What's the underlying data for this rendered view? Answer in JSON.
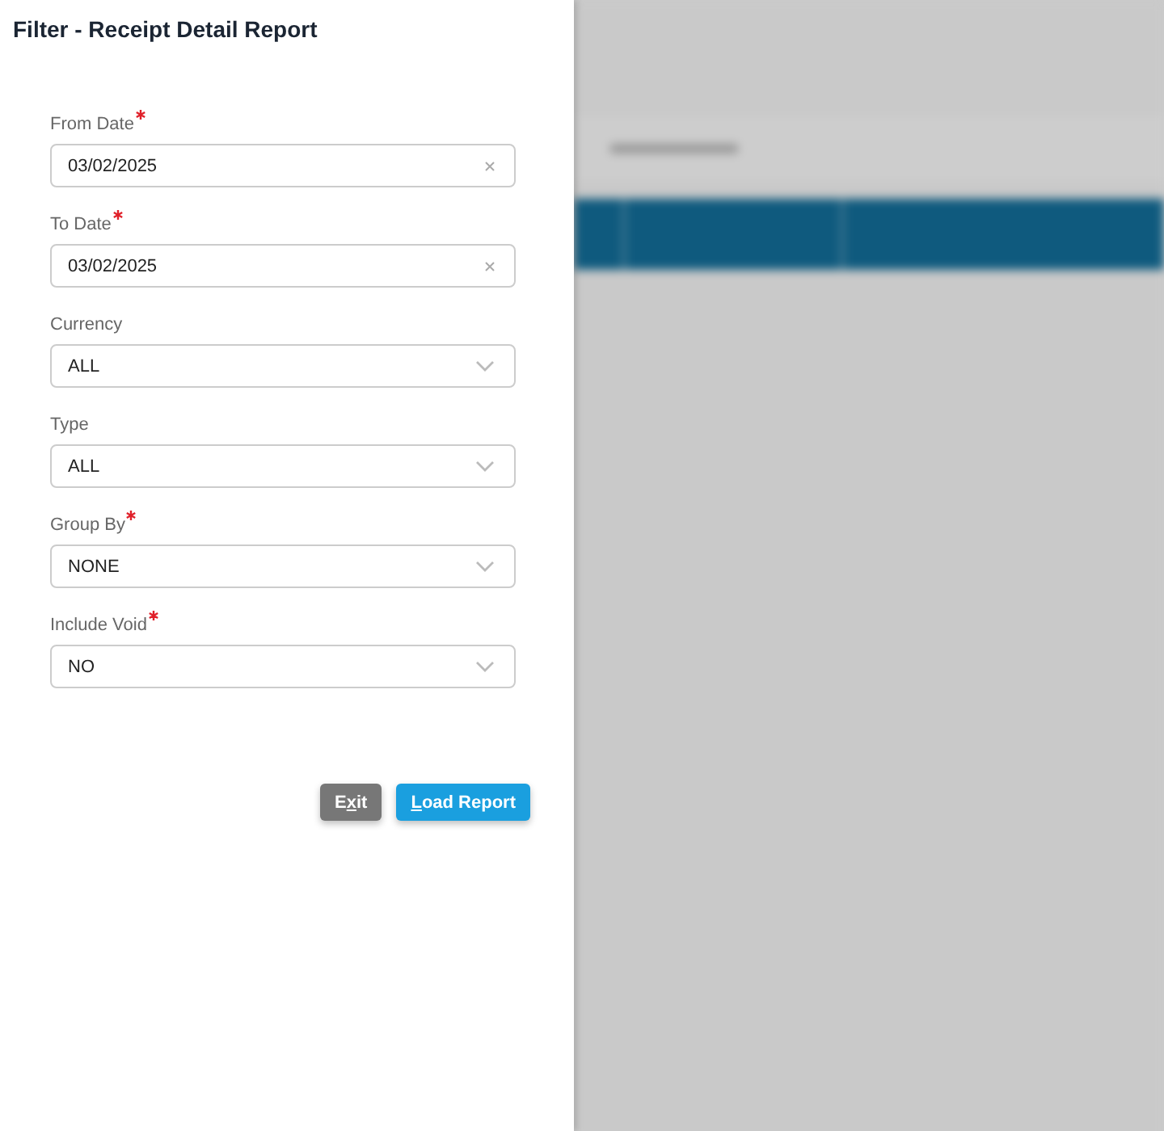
{
  "dialog": {
    "title": "Filter - Receipt Detail Report"
  },
  "fields": [
    {
      "kind": "date",
      "label": "From Date",
      "required": true,
      "value": "03/02/2025"
    },
    {
      "kind": "date",
      "label": "To Date",
      "required": true,
      "value": "03/02/2025"
    },
    {
      "kind": "select",
      "label": "Currency",
      "required": false,
      "value": "ALL"
    },
    {
      "kind": "select",
      "label": "Type",
      "required": false,
      "value": "ALL"
    },
    {
      "kind": "select",
      "label": "Group By",
      "required": true,
      "value": "NONE"
    },
    {
      "kind": "select",
      "label": "Include Void",
      "required": true,
      "value": "NO"
    }
  ],
  "buttons": [
    {
      "kind": "secondary",
      "label_start": "E",
      "access_key": "x",
      "label_rest": "it"
    },
    {
      "kind": "primary",
      "access_key": "L",
      "label_rest": "oad Report"
    }
  ]
}
